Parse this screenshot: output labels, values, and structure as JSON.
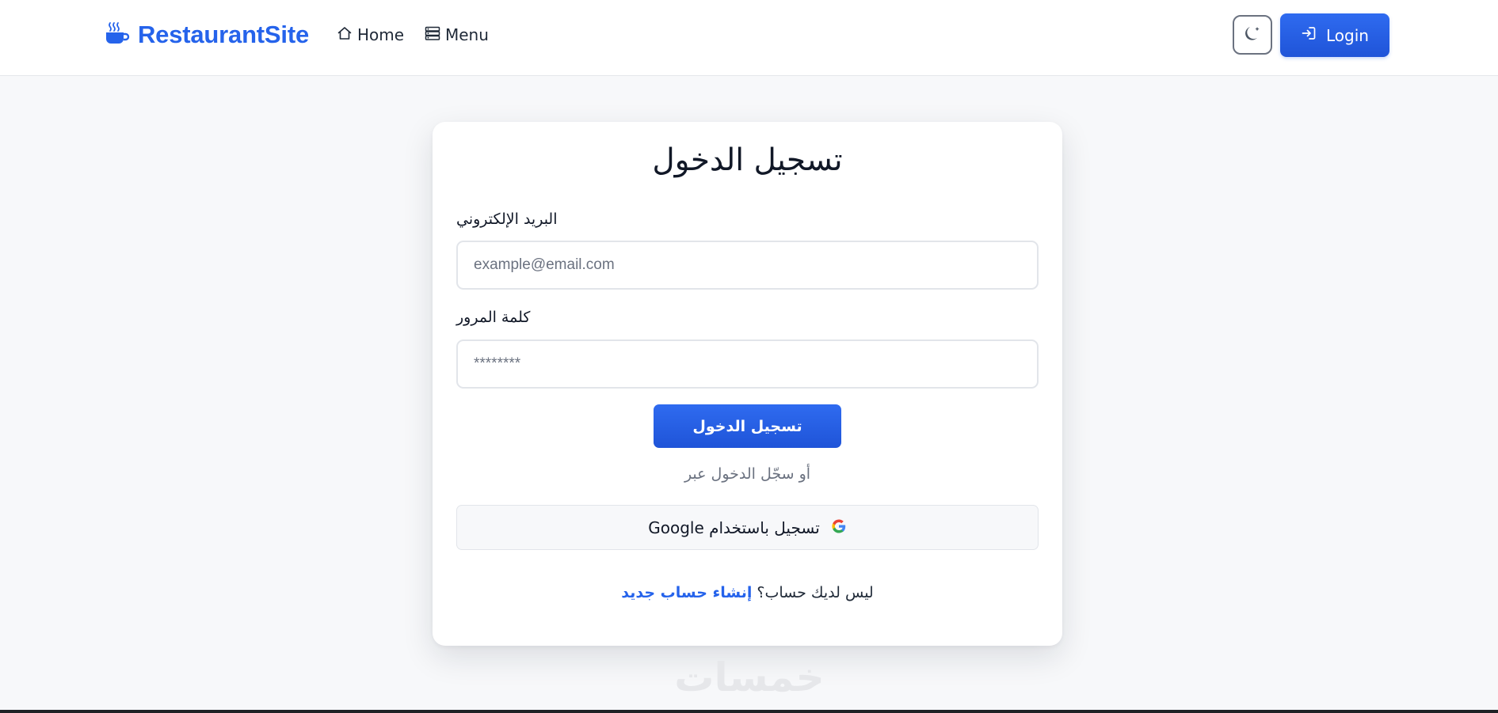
{
  "navbar": {
    "brand": "RestaurantSite",
    "brand_icon": "coffee-cup-icon",
    "links": [
      {
        "label": "Home",
        "icon": "home-icon"
      },
      {
        "label": "Menu",
        "icon": "menu-list-icon"
      }
    ],
    "theme_toggle_icon": "moon-icon",
    "login_label": "Login",
    "login_icon": "login-icon"
  },
  "login_form": {
    "title": "تسجيل الدخول",
    "email_label": "البريد الإلكتروني",
    "email_placeholder": "example@email.com",
    "password_label": "كلمة المرور",
    "password_placeholder": "********",
    "submit_label": "تسجيل الدخول",
    "or_text": "أو سجّل الدخول عبر",
    "google_label": "تسجيل باستخدام Google",
    "no_account_text": "ليس لديك حساب؟ ",
    "signup_link": "إنشاء حساب جديد"
  },
  "watermark": "خمسات",
  "colors": {
    "accent": "#2563eb",
    "background": "#f7f8fa",
    "card": "#ffffff"
  }
}
